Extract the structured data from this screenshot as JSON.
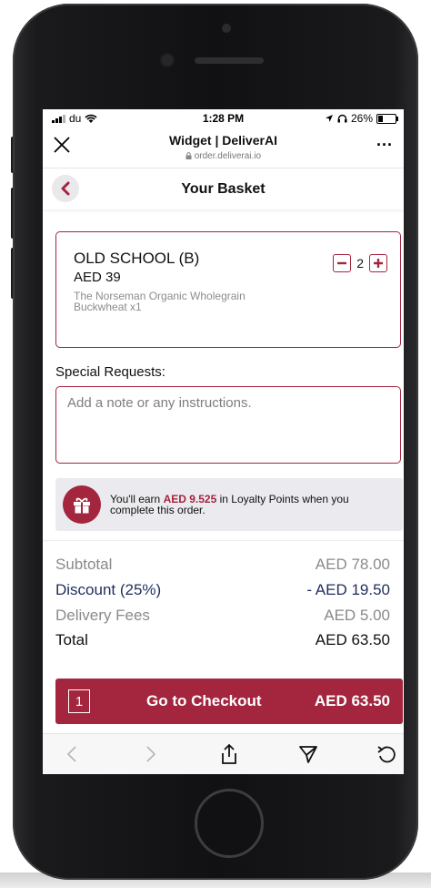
{
  "status_bar": {
    "carrier": "du",
    "time": "1:28 PM",
    "battery": "26%"
  },
  "browser": {
    "title": "Widget | DeliverAI",
    "url": "order.deliverai.io",
    "more": "..."
  },
  "header": {
    "title": "Your Basket"
  },
  "item": {
    "name": "OLD SCHOOL (B)",
    "price": "AED 39",
    "description": "The Norseman Organic Wholegrain Buckwheat x1",
    "quantity": "2"
  },
  "special_requests": {
    "label": "Special Requests:",
    "placeholder": "Add a note or any instructions."
  },
  "loyalty": {
    "prefix": "You'll earn ",
    "points": "AED 9.525",
    "suffix": " in Loyalty Points when you complete this order."
  },
  "totals": {
    "subtotal_label": "Subtotal",
    "subtotal_value": "AED 78.00",
    "discount_label": "Discount (25%)",
    "discount_value": "- AED 19.50",
    "delivery_label": "Delivery Fees",
    "delivery_value": "AED 5.00",
    "total_label": "Total",
    "total_value": "AED 63.50"
  },
  "checkout": {
    "count": "1",
    "label": "Go to Checkout",
    "total": "AED 63.50"
  },
  "colors": {
    "accent": "#a3253e",
    "discount": "#1f2d5c",
    "loyalty_bg": "#ebebef"
  },
  "icons": {
    "back": "chevron-left-icon",
    "close": "close-icon",
    "gift": "gift-icon",
    "toolbar": [
      "back-arrow-icon",
      "forward-arrow-icon",
      "share-icon",
      "send-icon",
      "reload-icon"
    ]
  }
}
